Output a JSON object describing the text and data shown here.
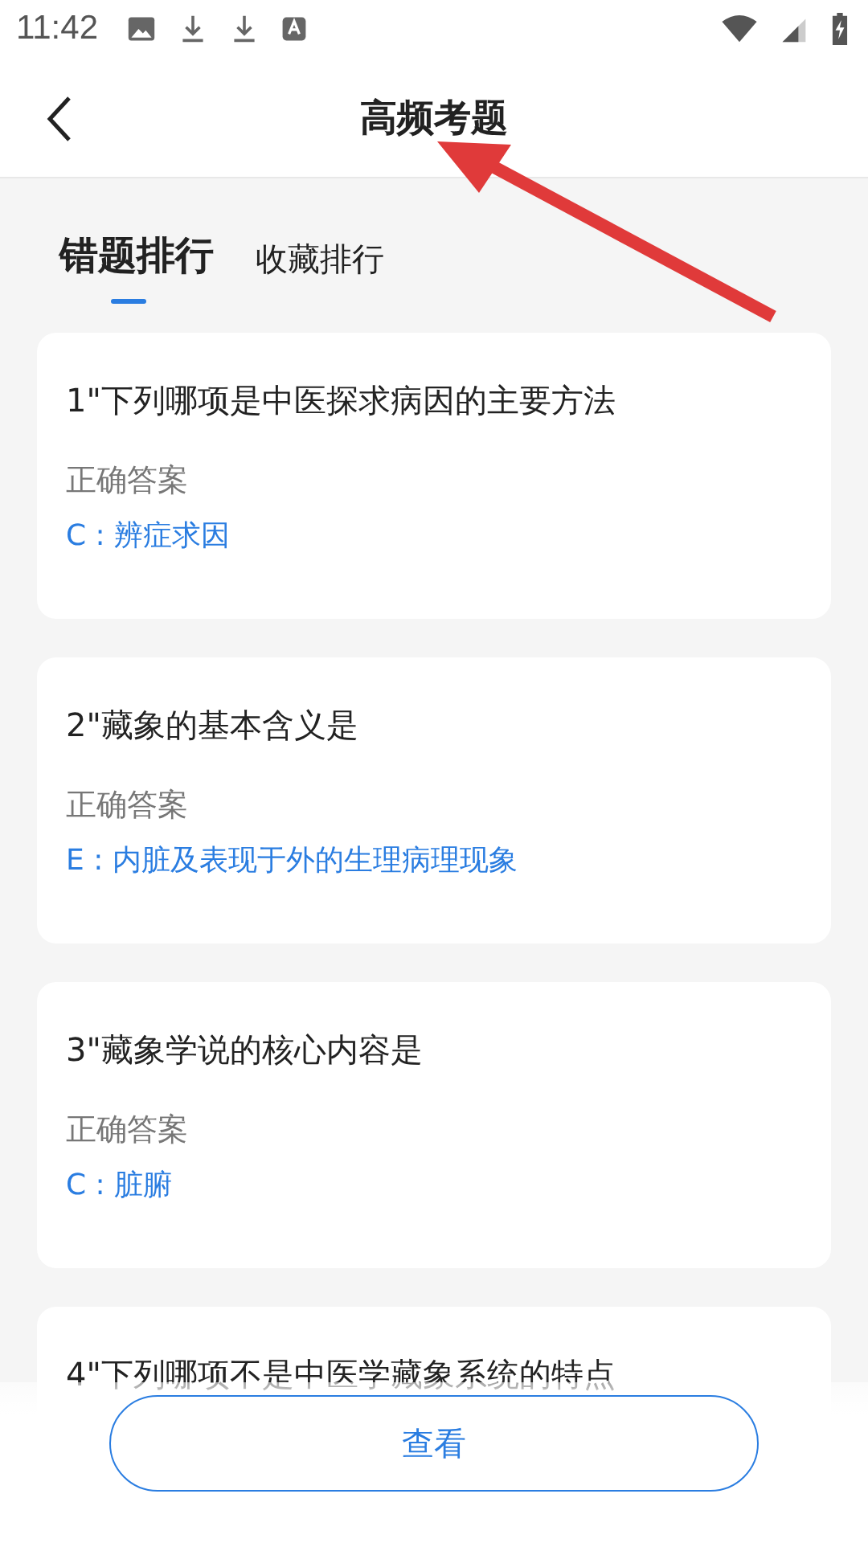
{
  "status_bar": {
    "time": "11:42"
  },
  "header": {
    "title": "高频考题"
  },
  "tabs": [
    {
      "label": "错题排行",
      "selected": true
    },
    {
      "label": "收藏排行",
      "selected": false
    }
  ],
  "questions": [
    {
      "question": "1\"下列哪项是中医探求病因的主要方法",
      "answer_label": "正确答案",
      "answer": "C : 辨症求因"
    },
    {
      "question": "2\"藏象的基本含义是",
      "answer_label": "正确答案",
      "answer": "E : 内脏及表现于外的生理病理现象"
    },
    {
      "question": "3\"藏象学说的核心内容是",
      "answer_label": "正确答案",
      "answer": "C : 脏腑"
    },
    {
      "question": "4\"下列哪项不是中医学藏象系统的特点"
    }
  ],
  "view_button": "查看"
}
